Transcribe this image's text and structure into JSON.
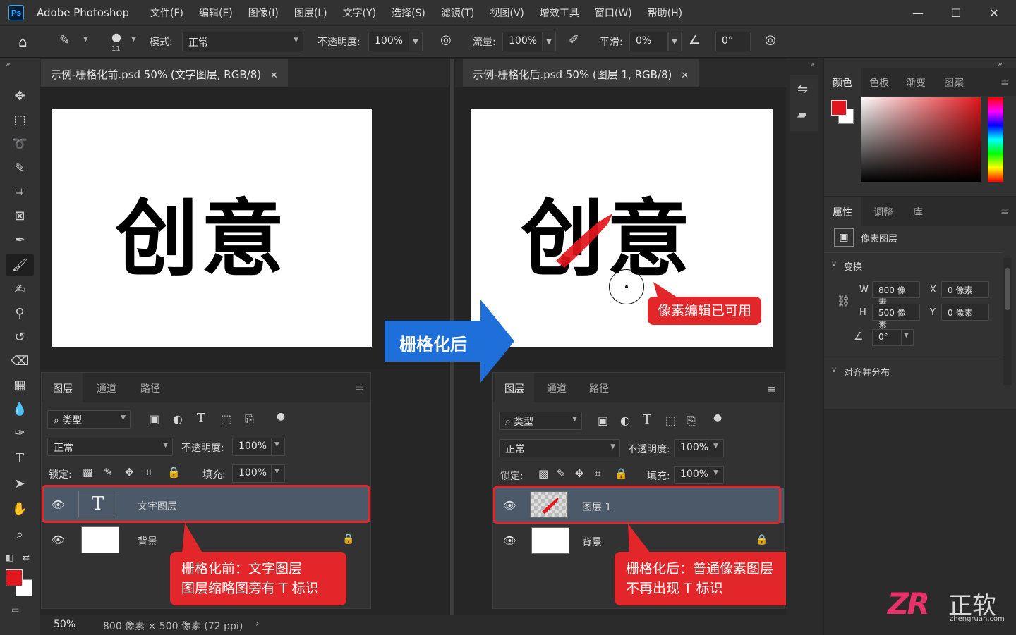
{
  "app": {
    "logo": "Ps",
    "title": "Adobe Photoshop"
  },
  "menu": [
    "文件(F)",
    "编辑(E)",
    "图像(I)",
    "图层(L)",
    "文字(Y)",
    "选择(S)",
    "滤镜(T)",
    "视图(V)",
    "增效工具",
    "窗口(W)",
    "帮助(H)"
  ],
  "window": {
    "minimize": "—",
    "maximize": "☐",
    "close": "✕"
  },
  "options": {
    "brush_size": "11",
    "mode_label": "模式:",
    "mode_value": "正常",
    "opacity_label": "不透明度:",
    "opacity_value": "100%",
    "flow_label": "流量:",
    "flow_value": "100%",
    "smooth_label": "平滑:",
    "smooth_value": "0%",
    "angle_value": "0°"
  },
  "left_doc": {
    "tab_title": "示例-栅格化前.psd   50% (文字图层, RGB/8)",
    "canvas_text": "创意",
    "layers": {
      "tabs": [
        "图层",
        "通道",
        "路径"
      ],
      "filter_label": "类型",
      "blend_mode": "正常",
      "opacity_label": "不透明度:",
      "opacity_value": "100%",
      "lock_label": "锁定:",
      "fill_label": "填充:",
      "fill_value": "100%",
      "items": [
        {
          "name": "文字图层",
          "thumb_glyph": "T"
        },
        {
          "name": "背景"
        }
      ]
    },
    "callout": [
      "栅格化前：文字图层",
      "图层缩略图旁有 T 标识"
    ]
  },
  "right_doc": {
    "tab_title": "示例-栅格化后.psd   50% (图层 1, RGB/8)",
    "canvas_text": "创意",
    "canvas_callout": "像素编辑已可用",
    "layers": {
      "tabs": [
        "图层",
        "通道",
        "路径"
      ],
      "filter_label": "类型",
      "blend_mode": "正常",
      "opacity_label": "不透明度:",
      "opacity_value": "100%",
      "lock_label": "锁定:",
      "fill_label": "填充:",
      "fill_value": "100%",
      "items": [
        {
          "name": "图层 1"
        },
        {
          "name": "背景"
        }
      ]
    },
    "callout": [
      "栅格化后：普通像素图层",
      "不再出现 T 标识"
    ]
  },
  "arrow_label": "栅格化后",
  "color_panel": {
    "tabs": [
      "颜色",
      "色板",
      "渐变",
      "图案"
    ],
    "foreground": "#e3161b",
    "background": "#ffffff"
  },
  "properties_panel": {
    "tabs": [
      "属性",
      "调整",
      "库"
    ],
    "layer_type": "像素图层",
    "transform_label": "变换",
    "w_label": "W",
    "w_value": "800 像素",
    "h_label": "H",
    "h_value": "500 像素",
    "x_label": "X",
    "x_value": "0 像素",
    "y_label": "Y",
    "y_value": "0 像素",
    "angle_value": "0°",
    "align_label": "对齐并分布"
  },
  "status": {
    "zoom": "50%",
    "info": "800 像素 × 500 像素 (72 ppi)"
  },
  "watermark": {
    "logo": "ZR",
    "brand": "正软",
    "url": "zhengruan.com"
  },
  "colors": {
    "accent_red": "#e3262a",
    "arrow_blue": "#1e6fd9",
    "selection": "#4b5969"
  }
}
